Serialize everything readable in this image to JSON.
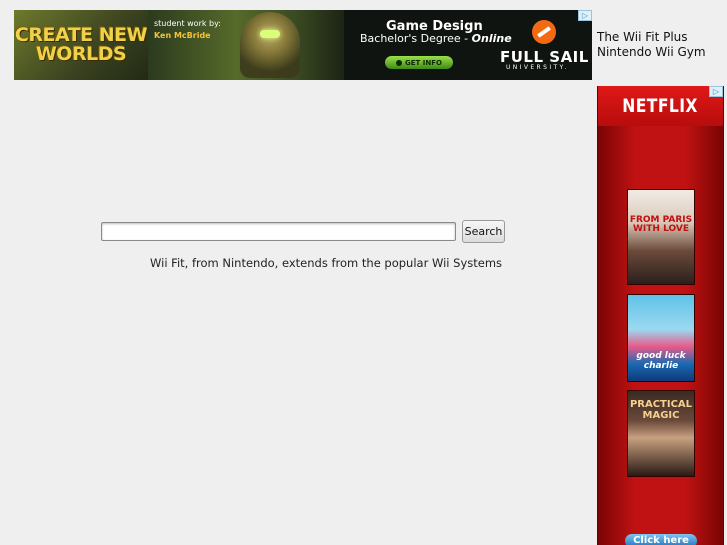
{
  "banner_ad": {
    "headline": "CREATE NEW WORLDS",
    "credit_label": "student work by:",
    "credit_name": "Ken McBride",
    "program_title": "Game Design",
    "degree_text": "Bachelor's Degree - ",
    "degree_emphasis": "Online",
    "cta_label": "GET INFO",
    "brand_name": "FULL SAIL",
    "brand_sub": "UNIVERSITY.",
    "adchoice_icon": "▷"
  },
  "side_links": {
    "line1": "The Wii Fit Plus",
    "line2": "Nintendo Wii Gym"
  },
  "search": {
    "value": "",
    "placeholder": "",
    "button_label": "Search"
  },
  "tagline": "Wii Fit, from Nintendo, extends from the popular Wii Systems",
  "netflix_ad": {
    "logo": "NETFLIX",
    "adchoice_icon": "▷",
    "poster1_title": "FROM PARIS WITH LOVE",
    "poster2_title": "good luck charlie",
    "poster3_title": "PRACTICAL MAGIC",
    "cta_label": "Click here"
  },
  "colors": {
    "page_bg": "#efefef",
    "netflix_red": "#b01010",
    "cta_green": "#6ec030"
  }
}
